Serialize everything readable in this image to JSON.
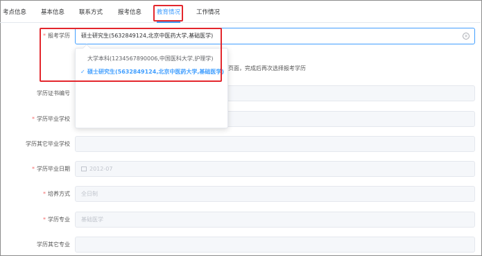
{
  "tabs": [
    {
      "label": "考点信息"
    },
    {
      "label": "基本信息"
    },
    {
      "label": "联系方式"
    },
    {
      "label": "报考信息"
    },
    {
      "label": "教育情况"
    },
    {
      "label": "工作情况"
    }
  ],
  "active_tab": "教育情况",
  "form": {
    "degree": {
      "label": "报考学历",
      "required": "*",
      "value": "硕士研究生(5632849124,北京中医药大学,基础医学)",
      "options": [
        {
          "label": "大学本科(1234567890006,中国医科大学,护理学)"
        },
        {
          "label": "硕士研究生(5632849124,北京中医药大学,基础医学)",
          "check": "✓"
        }
      ],
      "hint": "页面，完成后再次选择报考学历"
    },
    "cert_no": {
      "label": "学历证书编号",
      "value": ""
    },
    "grad_school": {
      "label": "学历毕业学校",
      "required": "*",
      "value": ""
    },
    "other_school": {
      "label": "学历其它毕业学校",
      "value": ""
    },
    "grad_date": {
      "label": "学历毕业日期",
      "required": "*",
      "value": "2012-07"
    },
    "training": {
      "label": "培养方式",
      "required": "*",
      "value": "全日制"
    },
    "major": {
      "label": "学历专业",
      "required": "*",
      "value": "基础医学"
    },
    "other_major": {
      "label": "学历其它专业",
      "value": ""
    }
  },
  "colors": {
    "accent": "#409eff",
    "highlight": "#e3262c",
    "required": "#f56c6c"
  },
  "icons": {
    "clear": "circle-close-icon",
    "calendar": "calendar-icon",
    "check": "check-icon"
  }
}
